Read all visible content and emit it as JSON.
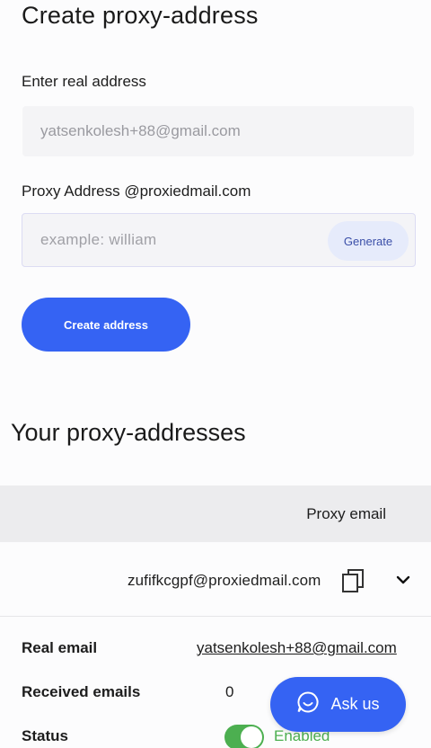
{
  "create": {
    "title": "Create proxy-address",
    "real_label": "Enter real address",
    "real_value": "yatsenkolesh+88@gmail.com",
    "proxy_label": "Proxy Address @proxiedmail.com",
    "proxy_placeholder": "example: william",
    "generate_label": "Generate",
    "create_label": "Create address"
  },
  "list": {
    "title": "Your proxy-addresses",
    "column_header": "Proxy email",
    "row": {
      "proxy_email": "zufifkcgpf@proxiedmail.com",
      "real_email_label": "Real email",
      "real_email_value": "yatsenkolesh+88@gmail.com",
      "received_label": "Received emails",
      "received_value": "0",
      "status_label": "Status",
      "status_value": "Enabled",
      "enabled": true
    }
  },
  "chat": {
    "label": "Ask us"
  },
  "icons": {
    "copy": "copy-icon",
    "chevron": "chevron-down-icon",
    "chat": "chat-bubble-icon"
  },
  "colors": {
    "accent": "#3563f3",
    "enabled": "#4caf50"
  }
}
